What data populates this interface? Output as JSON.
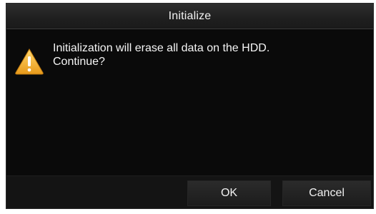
{
  "dialog": {
    "title": "Initialize",
    "icon": "warning-icon",
    "message_lines": [
      "Initialization will erase all data on the HDD.",
      "Continue?"
    ],
    "buttons": {
      "ok_label": "OK",
      "cancel_label": "Cancel"
    },
    "colors": {
      "background": "#0b0b0b",
      "warning_fill": "#f2b233"
    }
  }
}
